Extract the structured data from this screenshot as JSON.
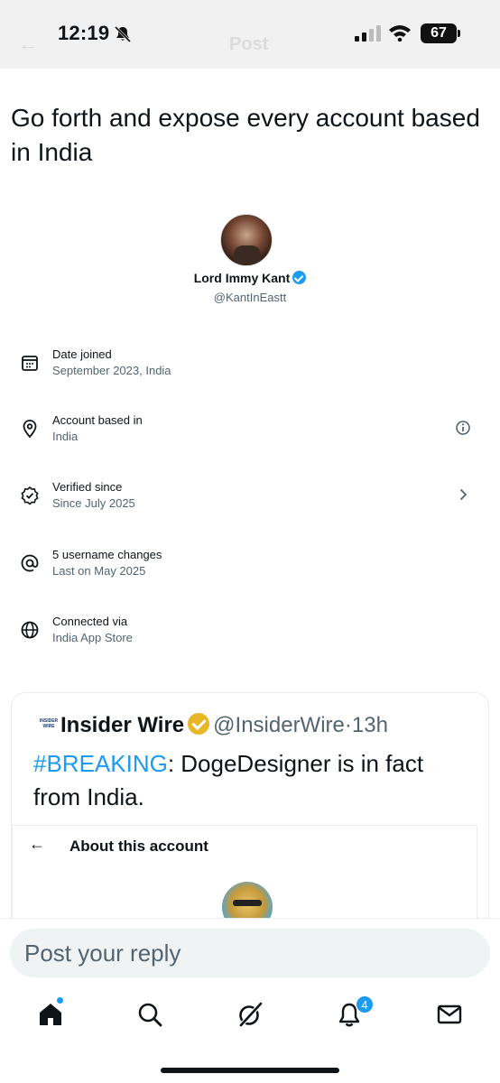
{
  "status_bar": {
    "time": "12:19",
    "battery": "67",
    "icons": [
      "bell-slash-icon",
      "cellular-signal-icon",
      "wifi-icon",
      "battery-icon"
    ]
  },
  "header": {
    "title": "Post"
  },
  "post": {
    "text": "Go forth and expose every account based in India"
  },
  "profile_card": {
    "name": "Lord Immy Kant",
    "handle": "@KantInEastt",
    "rows": [
      {
        "icon": "calendar-icon",
        "label": "Date joined",
        "value": "September 2023, India"
      },
      {
        "icon": "location-pin-icon",
        "label": "Account based in",
        "value": "India",
        "right_icon": "info-icon"
      },
      {
        "icon": "verified-badge-outline-icon",
        "label": "Verified since",
        "value": "Since July 2025",
        "right_icon": "chevron-right-icon"
      },
      {
        "icon": "at-sign-icon",
        "label": "5 username changes",
        "value": "Last on May 2025"
      },
      {
        "icon": "globe-icon",
        "label": "Connected via",
        "value": "India App Store"
      }
    ]
  },
  "quote": {
    "logo_text": "INSIDER WIRE",
    "name": "Insider Wire",
    "handle": "@InsiderWire",
    "separator": "·",
    "time": "13h",
    "hashtag": "#BREAKING",
    "text_rest": ": DogeDesigner is in fact from India.",
    "inner_card": {
      "title": "About this account"
    }
  },
  "reply": {
    "placeholder": "Post your reply"
  },
  "tab_bar": {
    "notification_count": "4",
    "tabs": [
      "home-icon",
      "search-icon",
      "grok-icon",
      "notifications-bell-icon",
      "messages-envelope-icon"
    ]
  },
  "colors": {
    "accent": "#1d9bf0",
    "text_primary": "#0f1419",
    "text_secondary": "#536471",
    "gold_badge": "#e8b627"
  }
}
